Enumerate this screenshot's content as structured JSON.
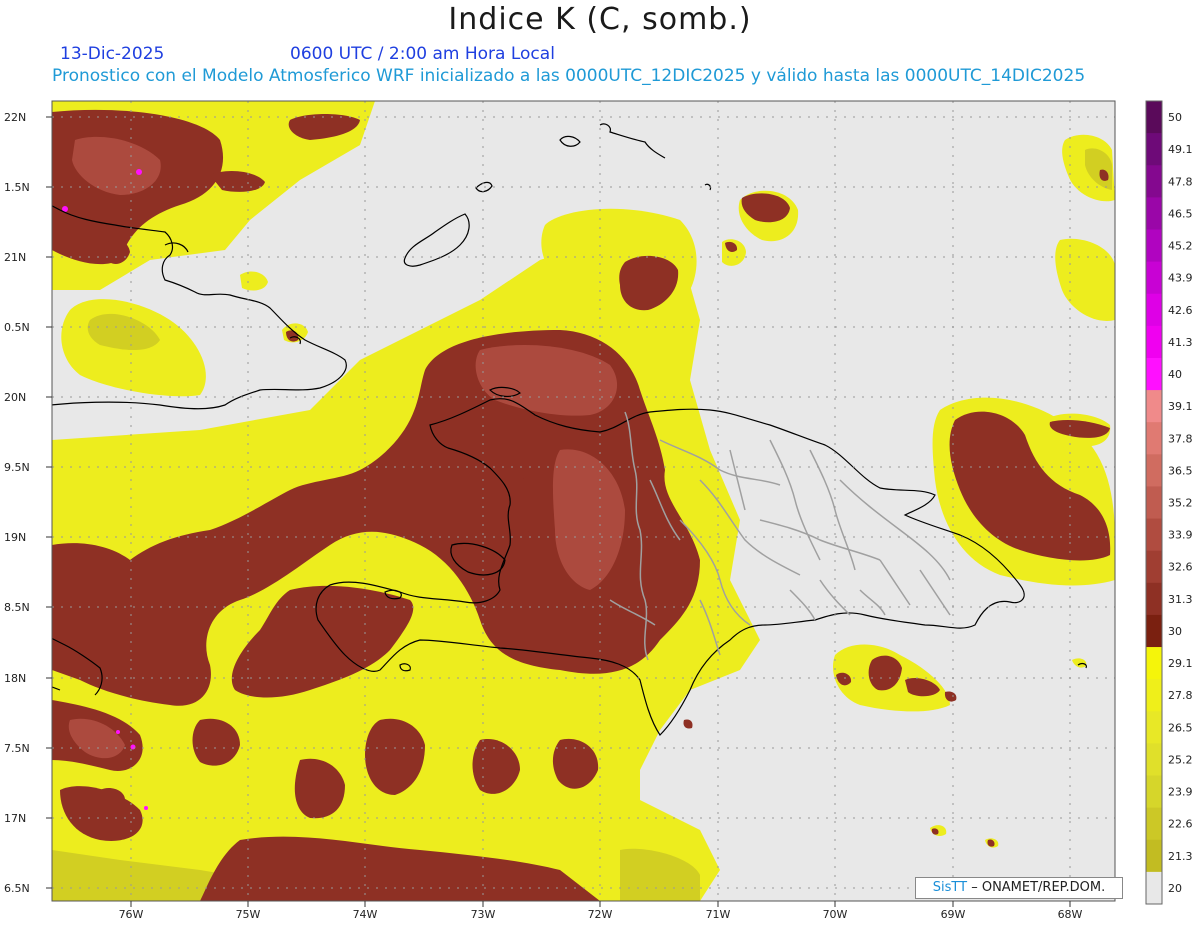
{
  "header": {
    "title": "Indice K (C, somb.)",
    "date": "13-Dic-2025",
    "time": "0600 UTC / 2:00 am Hora Local",
    "model_line": "Pronostico con el Modelo Atmosferico WRF inicializado a las 0000UTC_12DIC2025 y válido hasta las  0000UTC_14DIC2025"
  },
  "map": {
    "lat_labels": [
      "22N",
      "1.5N",
      "21N",
      "0.5N",
      "20N",
      "9.5N",
      "19N",
      "8.5N",
      "18N",
      "7.5N",
      "17N",
      "6.5N"
    ],
    "lon_labels": [
      "76W",
      "75W",
      "74W",
      "73W",
      "72W",
      "71W",
      "70W",
      "69W",
      "68W"
    ],
    "background_color": "#e8e8e8",
    "coast_color": "#000000",
    "border_color": "#a0a0a0"
  },
  "colorbar": {
    "labels": [
      "50",
      "49.1",
      "47.8",
      "46.5",
      "45.2",
      "43.9",
      "42.6",
      "41.3",
      "40",
      "39.1",
      "37.8",
      "36.5",
      "35.2",
      "33.9",
      "32.6",
      "31.3",
      "30",
      "29.1",
      "27.8",
      "26.5",
      "25.2",
      "23.9",
      "22.6",
      "21.3",
      "20"
    ],
    "colors": [
      "#5a0a5a",
      "#6e0a78",
      "#84088f",
      "#9a06a8",
      "#b004c0",
      "#c802d4",
      "#de00e6",
      "#f000f0",
      "#ff10ff",
      "#f08a8a",
      "#e07a72",
      "#d06c60",
      "#c05c50",
      "#b04c40",
      "#a03e32",
      "#8e3024",
      "#7a2010",
      "#f5f50a",
      "#efef1a",
      "#e8e826",
      "#e0e02a",
      "#d6d62a",
      "#ccc826",
      "#c2bc22",
      "#e8e8e8"
    ]
  },
  "credit": {
    "brand": "SisTT",
    "text": "– ONAMET/REP.DOM."
  }
}
